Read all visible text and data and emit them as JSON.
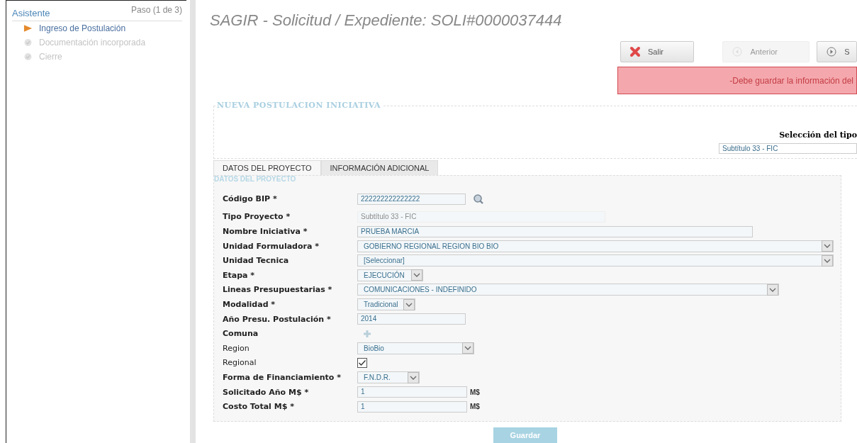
{
  "sidebar": {
    "title": "Asistente",
    "step": "Paso (1 de 3)",
    "items": [
      {
        "label": "Ingreso de Postulación",
        "selected": true
      },
      {
        "label": "Documentación incorporada",
        "selected": false
      },
      {
        "label": "Cierre",
        "selected": false
      }
    ]
  },
  "title": "SAGIR - Solicitud / Expediente: SOLI#0000037444",
  "toolbar": [
    {
      "kind": "exit",
      "label": "Salir",
      "disabled": false
    },
    {
      "kind": "previous",
      "label": "Anterior",
      "disabled": true
    },
    {
      "kind": "next",
      "label": "S",
      "disabled": false
    }
  ],
  "alert": "-Debe guardar la información del",
  "section": {
    "legend": "NUEVA POSTULACION INICIATIVA",
    "type_label": "Selección del tipo",
    "type_value": "Subtítulo 33 - FIC"
  },
  "tabs": [
    {
      "label": "DATOS DEL PROYECTO",
      "selected": true
    },
    {
      "label": "INFORMACIÓN ADICIONAL",
      "selected": false
    }
  ],
  "form": {
    "legend": "DATOS DEL PROYECTO",
    "rows": [
      {
        "kind": "search",
        "label": "Código BIP *",
        "bold": true,
        "value": "222222222222222"
      },
      {
        "kind": "readonly",
        "label": "Tipo Proyecto *",
        "bold": true,
        "value": "Subtítulo 33 - FIC"
      },
      {
        "kind": "text",
        "label": "Nombre Iniciativa *",
        "bold": true,
        "value": "PRUEBA MARCIA"
      },
      {
        "kind": "select",
        "label": "Unidad Formuladora *",
        "bold": true,
        "value": "GOBIERNO REGIONAL REGION BIO BIO"
      },
      {
        "kind": "select",
        "label": "Unidad Tecnica",
        "bold": true,
        "value": "[Seleccionar]"
      },
      {
        "kind": "select",
        "label": "Etapa *",
        "bold": true,
        "value": "EJECUCIÓN"
      },
      {
        "kind": "select",
        "label": "Lineas Presupuestarias *",
        "bold": true,
        "value": "COMUNICACIONES - INDEFINIDO"
      },
      {
        "kind": "select",
        "label": "Modalidad *",
        "bold": true,
        "value": "Tradicional"
      },
      {
        "kind": "text",
        "label": "Año Presu. Postulación *",
        "bold": true,
        "value": "2014"
      },
      {
        "kind": "add",
        "label": "Comuna",
        "bold": true
      },
      {
        "kind": "select",
        "label": "Region",
        "bold": false,
        "value": "BioBio"
      },
      {
        "kind": "checkbox",
        "label": "Regional",
        "bold": false,
        "checked": true
      },
      {
        "kind": "select",
        "label": "Forma de Financiamiento *",
        "bold": true,
        "value": "F.N.D.R."
      },
      {
        "kind": "text",
        "label": "Solicitado Año M$ *",
        "bold": true,
        "value": "1",
        "unit": "M$"
      },
      {
        "kind": "text",
        "label": "Costo Total M$ *",
        "bold": true,
        "value": "1",
        "unit": "M$"
      }
    ]
  },
  "save": "Guardar"
}
